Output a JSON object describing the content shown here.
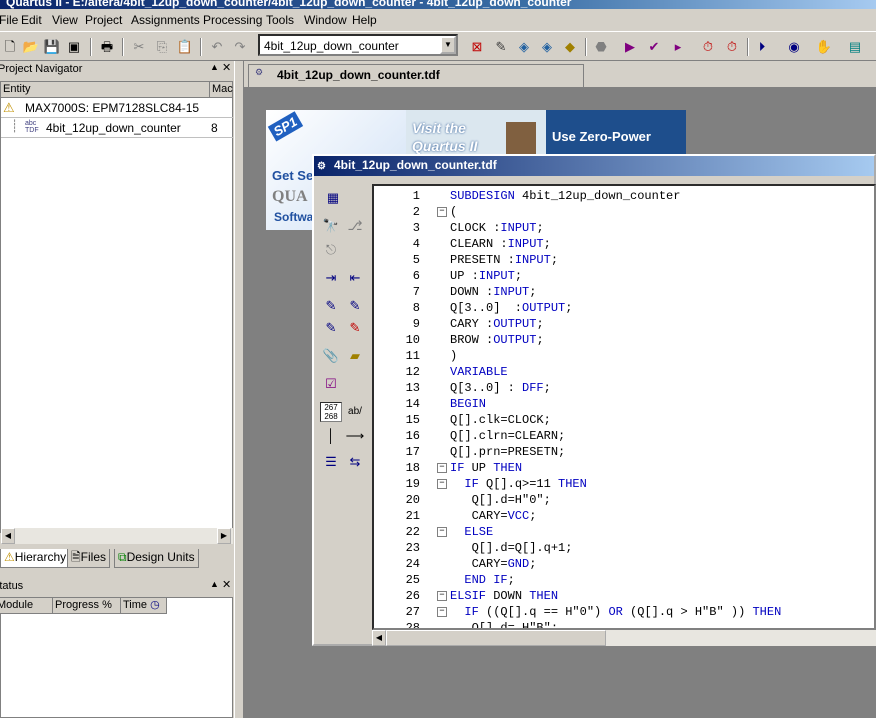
{
  "window": {
    "title": "Quartus II - E:/altera/4bit_12up_down_counter/4bit_12up_down_counter - 4bit_12up_down_counter"
  },
  "menu": [
    {
      "label": "File"
    },
    {
      "label": "Edit"
    },
    {
      "label": "View"
    },
    {
      "label": "Project"
    },
    {
      "label": "Assignments"
    },
    {
      "label": "Processing"
    },
    {
      "label": "Tools"
    },
    {
      "label": "Window"
    },
    {
      "label": "Help"
    }
  ],
  "toolbar": {
    "entity_combo_value": "4bit_12up_down_counter"
  },
  "project_navigator": {
    "title": "Project Navigator",
    "col_entity": "Entity",
    "col_mac": "Mac",
    "rows": [
      {
        "entity": "MAX7000S: EPM7128SLC84-15",
        "mac": ""
      },
      {
        "entity": "4bit_12up_down_counter",
        "mac": "8"
      }
    ],
    "tabs": [
      {
        "label": "Hierarchy"
      },
      {
        "label": "Files"
      },
      {
        "label": "Design Units"
      }
    ]
  },
  "status_panel": {
    "title": "Status",
    "col_module": "Module",
    "col_progress": "Progress %",
    "col_time": "Time"
  },
  "doc_tab": {
    "label": "4bit_12up_down_counter.tdf"
  },
  "banner": {
    "sp1": "SP1",
    "visit": "Visit the",
    "quartus": "Quartus II",
    "zero_power": "Use Zero-Power",
    "get_ser": "Get Ser",
    "qua": "QUA",
    "softwa": "Softwa"
  },
  "editor": {
    "title": "4bit_12up_down_counter.tdf",
    "lines": [
      {
        "n": "1",
        "text": "SUBDESIGN 4bit_12up_down_counter"
      },
      {
        "n": "2",
        "text": "("
      },
      {
        "n": "3",
        "text": "CLOCK :INPUT;"
      },
      {
        "n": "4",
        "text": "CLEARN :INPUT;"
      },
      {
        "n": "5",
        "text": "PRESETN :INPUT;"
      },
      {
        "n": "6",
        "text": "UP :INPUT;"
      },
      {
        "n": "7",
        "text": "DOWN :INPUT;"
      },
      {
        "n": "8",
        "text": "Q[3..0]  :OUTPUT;"
      },
      {
        "n": "9",
        "text": "CARY :OUTPUT;"
      },
      {
        "n": "10",
        "text": "BROW :OUTPUT;"
      },
      {
        "n": "11",
        "text": ")"
      },
      {
        "n": "12",
        "text": "VARIABLE"
      },
      {
        "n": "13",
        "text": "Q[3..0] : DFF;"
      },
      {
        "n": "14",
        "text": "BEGIN"
      },
      {
        "n": "15",
        "text": "Q[].clk=CLOCK;"
      },
      {
        "n": "16",
        "text": "Q[].clrn=CLEARN;"
      },
      {
        "n": "17",
        "text": "Q[].prn=PRESETN;"
      },
      {
        "n": "18",
        "text": "IF UP THEN"
      },
      {
        "n": "19",
        "text": "  IF Q[].q>=11 THEN"
      },
      {
        "n": "20",
        "text": "   Q[].d=H\"0\";"
      },
      {
        "n": "21",
        "text": "   CARY=VCC;"
      },
      {
        "n": "22",
        "text": "  ELSE"
      },
      {
        "n": "23",
        "text": "   Q[].d=Q[].q+1;"
      },
      {
        "n": "24",
        "text": "   CARY=GND;"
      },
      {
        "n": "25",
        "text": "  END IF;"
      },
      {
        "n": "26",
        "text": "ELSIF DOWN THEN"
      },
      {
        "n": "27",
        "text": "  IF ((Q[].q == H\"0\") OR (Q[].q > H\"B\" )) THEN"
      },
      {
        "n": "28",
        "text": "   Q[].d= H\"B\";"
      }
    ],
    "tool_labels": {
      "num": "267\n268",
      "ab": "ab/"
    }
  },
  "colors": {
    "keyword": "#0000c0",
    "title_start": "#0a246a",
    "title_end": "#a6caf0"
  }
}
